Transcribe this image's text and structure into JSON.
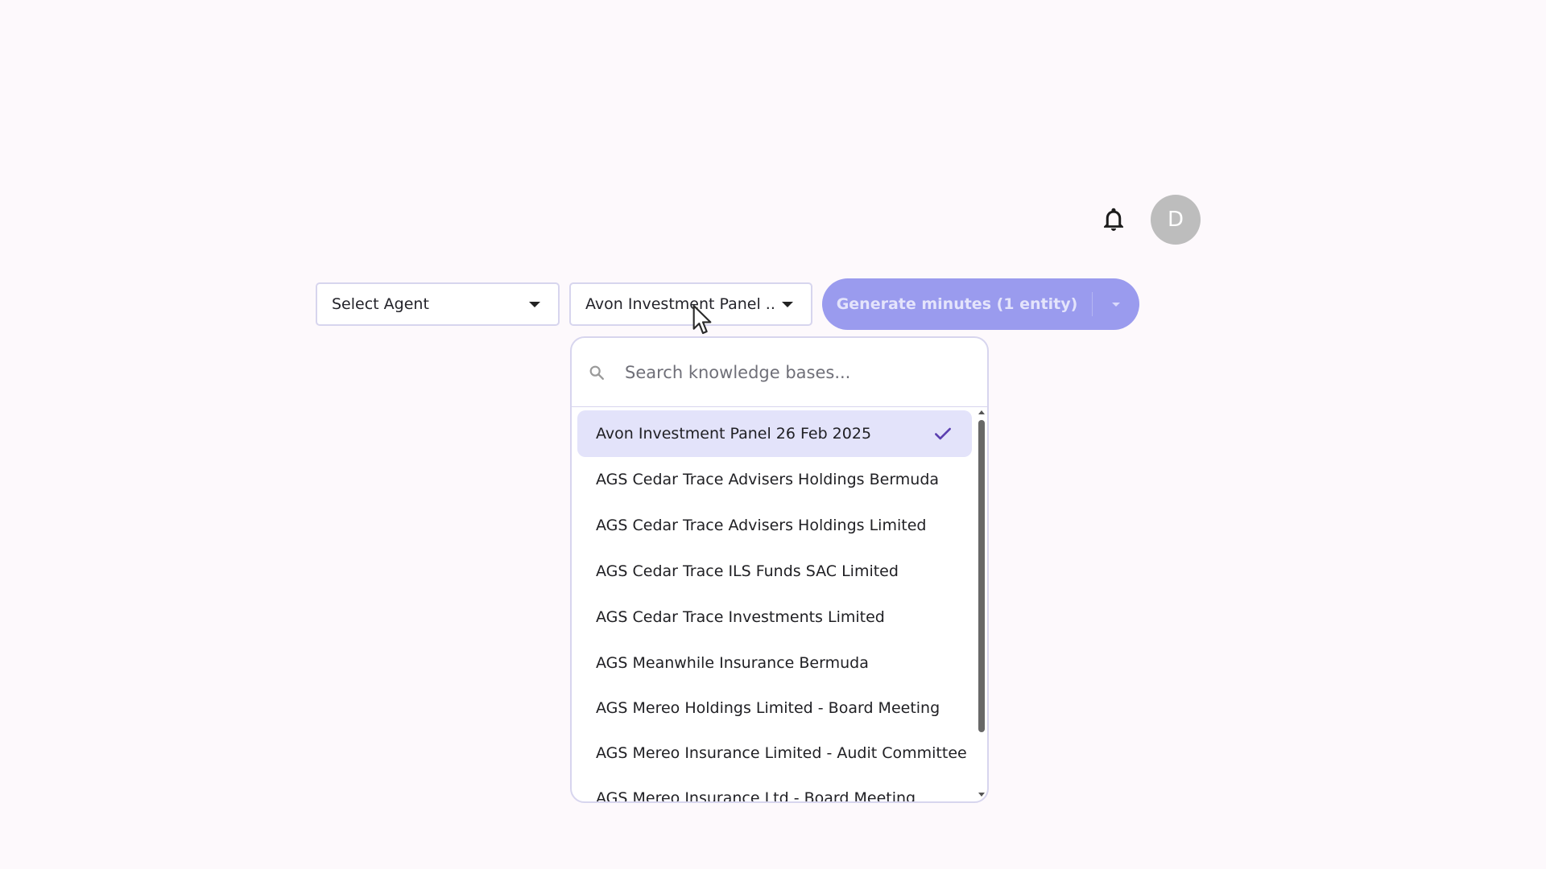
{
  "header": {
    "notification_icon": "bell-icon",
    "avatar_initial": "D"
  },
  "toolbar": {
    "agent_select_label": "Select Agent",
    "kb_select_label": "Avon Investment Panel ...",
    "generate_label": "Generate minutes (1 entity)"
  },
  "dropdown": {
    "search_placeholder": "Search knowledge bases...",
    "selected_index": 0,
    "items": [
      {
        "label": "Avon Investment Panel 26 Feb 2025"
      },
      {
        "label": "AGS Cedar Trace Advisers Holdings Bermuda"
      },
      {
        "label": "AGS Cedar Trace Advisers Holdings Limited"
      },
      {
        "label": "AGS Cedar Trace ILS Funds SAC Limited"
      },
      {
        "label": "AGS Cedar Trace Investments Limited"
      },
      {
        "label": "AGS Meanwhile Insurance Bermuda"
      },
      {
        "label": "AGS Mereo Holdings Limited - Board Meeting"
      },
      {
        "label": "AGS Mereo Insurance Limited - Audit Committee"
      },
      {
        "label": "AGS Mereo Insurance Ltd - Board Meeting"
      }
    ]
  },
  "colors": {
    "accent": "#9a9bee",
    "selected_bg": "#e3e3fa",
    "check": "#5b3fb0",
    "border": "#d7d5ee",
    "page_bg": "#fdf9fc"
  }
}
